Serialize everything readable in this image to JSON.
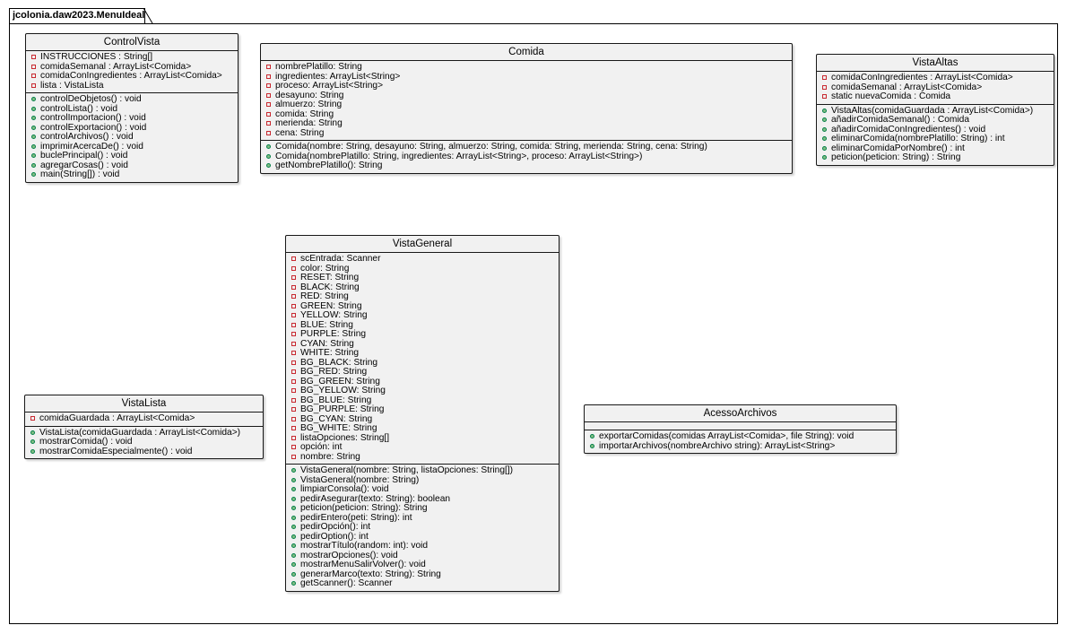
{
  "package": {
    "name": "jcolonia.daw2023.MenuIdeal"
  },
  "colors": {
    "private_marker": "#c82930",
    "public_marker": "#84be84",
    "class_fill": "#f1f1f1"
  },
  "classes": [
    {
      "name": "ControlVista",
      "attributes": [
        {
          "vis": "private",
          "text": "INSTRUCCIONES : String[]"
        },
        {
          "vis": "private",
          "text": "comidaSemanal : ArrayList<Comida>"
        },
        {
          "vis": "private",
          "text": "comidaConIngredientes : ArrayList<Comida>"
        },
        {
          "vis": "private",
          "text": "lista  : VistaLista"
        }
      ],
      "methods": [
        {
          "vis": "public",
          "text": "controlDeObjetos() : void"
        },
        {
          "vis": "public",
          "text": "controlLista() : void"
        },
        {
          "vis": "public",
          "text": "controlImportacion() : void"
        },
        {
          "vis": "public",
          "text": "controlExportacion() : void"
        },
        {
          "vis": "public",
          "text": "controlArchivos() : void"
        },
        {
          "vis": "public",
          "text": "imprimirAcercaDe() : void"
        },
        {
          "vis": "public",
          "text": "buclePrincipal() : void"
        },
        {
          "vis": "public",
          "text": "agregarCosas() : void"
        },
        {
          "vis": "public",
          "text": "main(String[]) : void"
        }
      ]
    },
    {
      "name": "Comida",
      "attributes": [
        {
          "vis": "private",
          "text": "nombrePlatillo: String"
        },
        {
          "vis": "private",
          "text": "ingredientes: ArrayList<String>"
        },
        {
          "vis": "private",
          "text": "proceso: ArrayList<String>"
        },
        {
          "vis": "private",
          "text": "desayuno: String"
        },
        {
          "vis": "private",
          "text": "almuerzo: String"
        },
        {
          "vis": "private",
          "text": "comida: String"
        },
        {
          "vis": "private",
          "text": "merienda: String"
        },
        {
          "vis": "private",
          "text": "cena: String"
        }
      ],
      "methods": [
        {
          "vis": "public",
          "text": "Comida(nombre: String, desayuno: String, almuerzo: String, comida: String, merienda: String, cena: String)"
        },
        {
          "vis": "public",
          "text": "Comida(nombrePlatillo: String, ingredientes: ArrayList<String>, proceso: ArrayList<String>)"
        },
        {
          "vis": "public",
          "text": "getNombrePlatillo(): String"
        }
      ]
    },
    {
      "name": "VistaAltas",
      "attributes": [
        {
          "vis": "private",
          "text": "comidaConIngredientes : ArrayList<Comida>"
        },
        {
          "vis": "private",
          "text": "comidaSemanal : ArrayList<Comida>"
        },
        {
          "vis": "private",
          "text": "static nuevaComida : Comida"
        }
      ],
      "methods": [
        {
          "vis": "public",
          "text": "VistaAltas(comidaGuardada : ArrayList<Comida>)"
        },
        {
          "vis": "public",
          "text": "añadirComidaSemanal() : Comida"
        },
        {
          "vis": "public",
          "text": "añadirComidaConIngredientes() : void"
        },
        {
          "vis": "public",
          "text": "eliminarComida(nombrePlatillo: String) : int"
        },
        {
          "vis": "public",
          "text": "eliminarComidaPorNombre() : int"
        },
        {
          "vis": "public",
          "text": "peticion(peticion: String) : String"
        }
      ]
    },
    {
      "name": "VistaGeneral",
      "attributes": [
        {
          "vis": "private",
          "text": "scEntrada: Scanner"
        },
        {
          "vis": "private",
          "text": "color: String"
        },
        {
          "vis": "private",
          "text": "RESET: String"
        },
        {
          "vis": "private",
          "text": "BLACK: String"
        },
        {
          "vis": "private",
          "text": "RED: String"
        },
        {
          "vis": "private",
          "text": "GREEN: String"
        },
        {
          "vis": "private",
          "text": "YELLOW: String"
        },
        {
          "vis": "private",
          "text": "BLUE: String"
        },
        {
          "vis": "private",
          "text": "PURPLE: String"
        },
        {
          "vis": "private",
          "text": "CYAN: String"
        },
        {
          "vis": "private",
          "text": "WHITE: String"
        },
        {
          "vis": "private",
          "text": "BG_BLACK: String"
        },
        {
          "vis": "private",
          "text": "BG_RED: String"
        },
        {
          "vis": "private",
          "text": "BG_GREEN: String"
        },
        {
          "vis": "private",
          "text": "BG_YELLOW: String"
        },
        {
          "vis": "private",
          "text": "BG_BLUE: String"
        },
        {
          "vis": "private",
          "text": "BG_PURPLE: String"
        },
        {
          "vis": "private",
          "text": "BG_CYAN: String"
        },
        {
          "vis": "private",
          "text": "BG_WHITE: String"
        },
        {
          "vis": "private",
          "text": "listaOpciones: String[]"
        },
        {
          "vis": "private",
          "text": "opción: int"
        },
        {
          "vis": "private",
          "text": "nombre: String"
        }
      ],
      "methods": [
        {
          "vis": "public",
          "text": "VistaGeneral(nombre: String, listaOpciones: String[])"
        },
        {
          "vis": "public",
          "text": "VistaGeneral(nombre: String)"
        },
        {
          "vis": "public",
          "text": "limpiarConsola(): void"
        },
        {
          "vis": "public",
          "text": "pedirAsegurar(texto: String): boolean"
        },
        {
          "vis": "public",
          "text": "peticion(peticion: String): String"
        },
        {
          "vis": "public",
          "text": "pedirEntero(peti: String): int"
        },
        {
          "vis": "public",
          "text": "pedirOpción(): int"
        },
        {
          "vis": "public",
          "text": "pedirOption(): int"
        },
        {
          "vis": "public",
          "text": "mostrarTítulo(random: int): void"
        },
        {
          "vis": "public",
          "text": "mostrarOpciones(): void"
        },
        {
          "vis": "public",
          "text": "mostrarMenuSalirVolver(): void"
        },
        {
          "vis": "public",
          "text": "generarMarco(texto: String): String"
        },
        {
          "vis": "public",
          "text": "getScanner(): Scanner"
        }
      ]
    },
    {
      "name": "VistaLista",
      "attributes": [
        {
          "vis": "private",
          "text": "comidaGuardada : ArrayList<Comida>"
        }
      ],
      "methods": [
        {
          "vis": "public",
          "text": "VistaLista(comidaGuardada : ArrayList<Comida>)"
        },
        {
          "vis": "public",
          "text": "mostrarComida() : void"
        },
        {
          "vis": "public",
          "text": "mostrarComidaEspecialmente() : void"
        }
      ]
    },
    {
      "name": "AcessoArchivos",
      "attributes": [],
      "methods": [
        {
          "vis": "public",
          "text": "exportarComidas(comidas ArrayList<Comida>, file String): void"
        },
        {
          "vis": "public",
          "text": "importarArchivos(nombreArchivo string): ArrayList<String>"
        }
      ]
    }
  ]
}
